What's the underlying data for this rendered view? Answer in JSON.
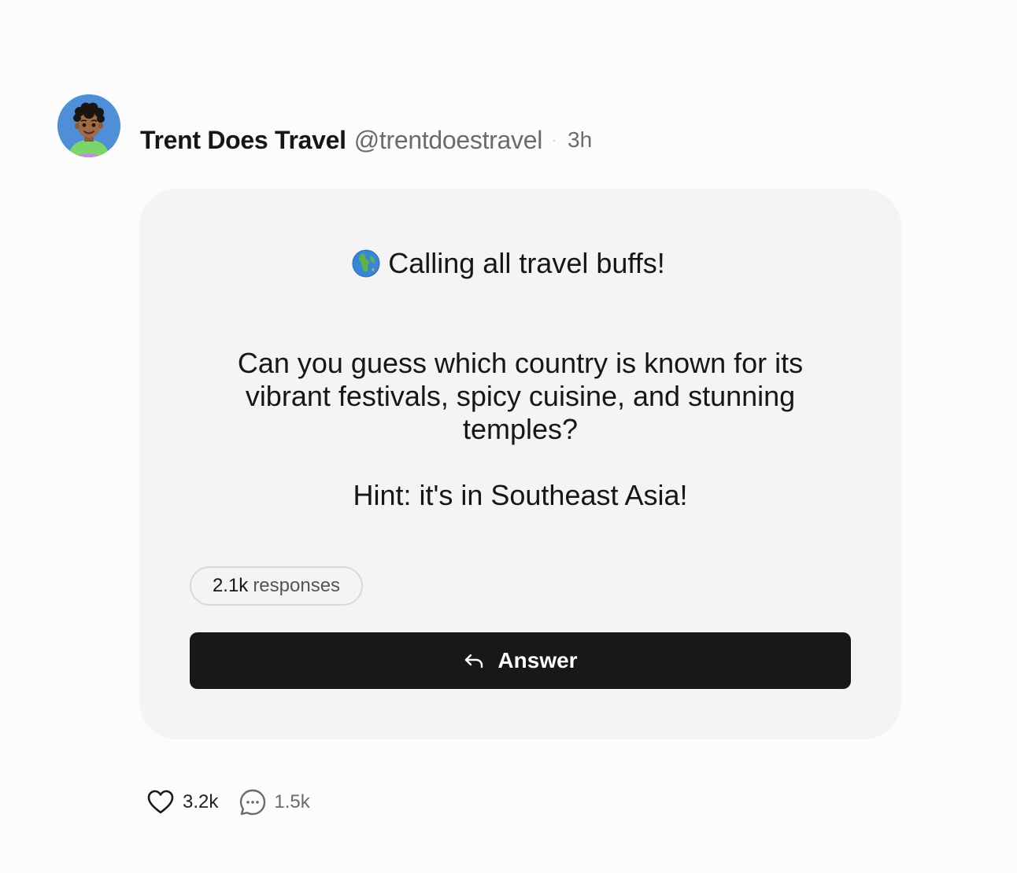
{
  "author": {
    "name": "Trent Does Travel",
    "handle": "@trentdoestravel",
    "separator": "·",
    "time": "3h",
    "avatar_icon": "avatar-illustration"
  },
  "card": {
    "title_icon": "globe-emoji",
    "title": "Calling all travel buffs!",
    "question": "Can you guess which country is known for its vibrant festivals, spicy cuisine, and stunning temples?",
    "hint": "Hint: it's in Southeast Asia!",
    "responses_count": "2.1k",
    "responses_label": "responses",
    "answer_label": "Answer",
    "answer_icon": "reply-arrow-icon"
  },
  "actions": {
    "likes": "3.2k",
    "comments": "1.5k"
  },
  "colors": {
    "page_bg": "#fcfcfc",
    "card_bg": "#f4f4f4",
    "button_bg": "#181818",
    "avatar_bg": "#4f8fd8"
  }
}
